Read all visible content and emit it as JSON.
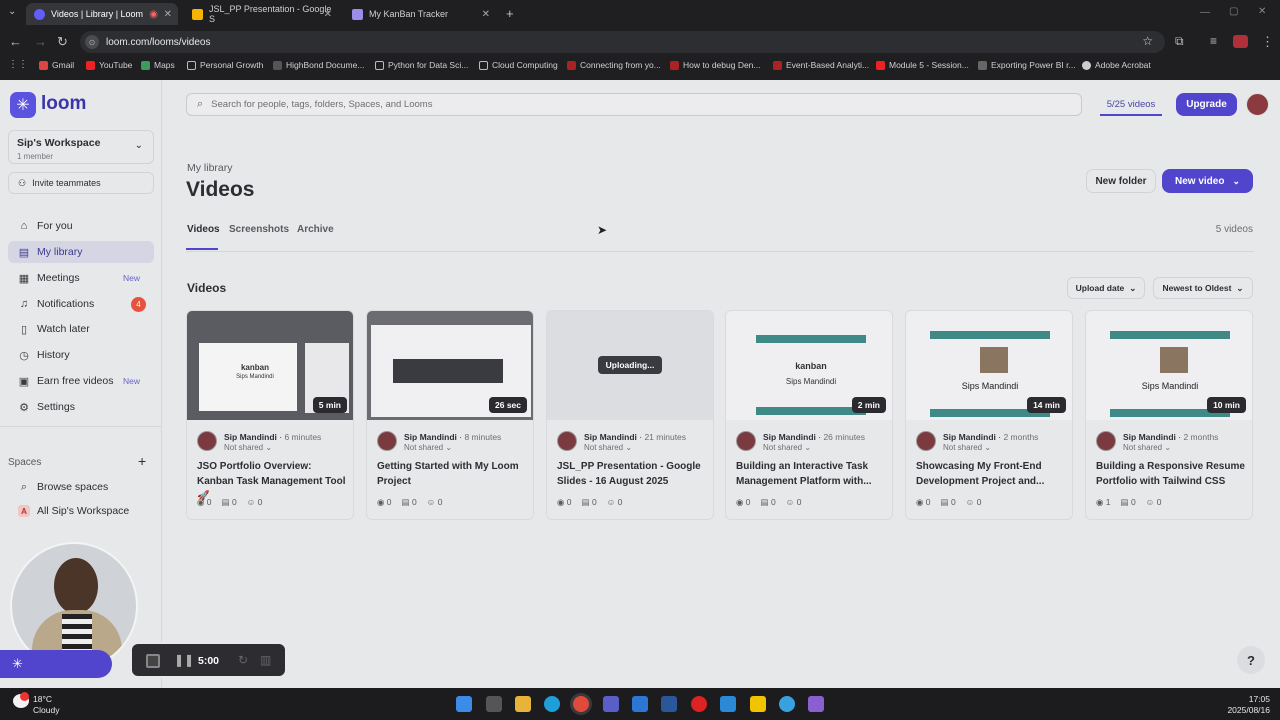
{
  "browser": {
    "tabs": [
      {
        "title": "Videos | Library | Loom",
        "active": true
      },
      {
        "title": "JSL_PP Presentation - Google S",
        "active": false
      },
      {
        "title": "My KanBan Tracker",
        "active": false
      }
    ],
    "url": "loom.com/looms/videos",
    "bookmarks": [
      "Gmail",
      "YouTube",
      "Maps",
      "Personal Growth",
      "HighBond Docume...",
      "Python for Data Sci...",
      "Cloud Computing",
      "Connecting from yo...",
      "How to debug Den...",
      "Event-Based Analyti...",
      "Module 5 - Session...",
      "Exporting Power BI r...",
      "Adobe Acrobat"
    ]
  },
  "app": {
    "logo_text": "loom",
    "search_placeholder": "Search for people, tags, folders, Spaces, and Looms",
    "video_quota": "5/25 videos",
    "upgrade_label": "Upgrade",
    "workspace": {
      "name": "Sip's Workspace",
      "members": "1 member"
    },
    "invite_label": "Invite teammates",
    "nav": [
      {
        "label": "For you",
        "icon": "home-icon"
      },
      {
        "label": "My library",
        "icon": "library-icon",
        "active": true
      },
      {
        "label": "Meetings",
        "icon": "calendar-icon",
        "badge": "New"
      },
      {
        "label": "Notifications",
        "icon": "bell-icon",
        "count": "4"
      },
      {
        "label": "Watch later",
        "icon": "bookmark-icon"
      },
      {
        "label": "History",
        "icon": "history-icon"
      },
      {
        "label": "Earn free videos",
        "icon": "gift-icon",
        "badge": "New"
      },
      {
        "label": "Settings",
        "icon": "gear-icon"
      }
    ],
    "spaces_label": "Spaces",
    "spaces": [
      {
        "label": "Browse spaces",
        "icon": "search-icon"
      },
      {
        "label": "All Sip's Workspace",
        "icon": "A"
      }
    ],
    "breadcrumb": "My library",
    "page_title": "Videos",
    "new_folder_label": "New folder",
    "new_video_label": "New video",
    "tabs": [
      "Videos",
      "Screenshots",
      "Archive"
    ],
    "video_count": "5 videos",
    "section_title": "Videos",
    "sort_field": "Upload date",
    "sort_order": "Newest to Oldest",
    "videos": [
      {
        "owner": "Sip Mandindi",
        "time": "6 minutes",
        "shared": "Not shared",
        "title": "JSO Portfolio Overview: Kanban Task Management Tool 🚀",
        "duration": "5 min",
        "views": "0",
        "comments": "0",
        "reactions": "0",
        "thumb_text": "kanban",
        "thumb_sub": "Sips Mandindi"
      },
      {
        "owner": "Sip Mandindi",
        "time": "8 minutes",
        "shared": "Not shared",
        "title": "Getting Started with My Loom Project",
        "duration": "26 sec",
        "views": "0",
        "comments": "0",
        "reactions": "0",
        "thumb_text": "",
        "thumb_sub": ""
      },
      {
        "owner": "Sip Mandindi",
        "time": "21 minutes",
        "shared": "Not shared",
        "title": "JSL_PP Presentation - Google Slides - 16 August 2025",
        "duration": "",
        "uploading": "Uploading...",
        "views": "0",
        "comments": "0",
        "reactions": "0",
        "thumb_text": "",
        "thumb_sub": ""
      },
      {
        "owner": "Sip Mandindi",
        "time": "26 minutes",
        "shared": "Not shared",
        "title": "Building an Interactive Task Management Platform with...",
        "duration": "2 min",
        "views": "0",
        "comments": "0",
        "reactions": "0",
        "thumb_text": "kanban",
        "thumb_sub": "Sips Mandindi"
      },
      {
        "owner": "Sip Mandindi",
        "time": "2 months",
        "shared": "Not shared",
        "title": "Showcasing My Front-End Development Project and...",
        "duration": "14 min",
        "views": "0",
        "comments": "0",
        "reactions": "0",
        "thumb_text": "",
        "thumb_sub": "Sips Mandindi"
      },
      {
        "owner": "Sip Mandindi",
        "time": "2 months",
        "shared": "Not shared",
        "title": "Building a Responsive Resume Portfolio with Tailwind CSS",
        "duration": "10 min",
        "views": "1",
        "comments": "0",
        "reactions": "0",
        "thumb_text": "",
        "thumb_sub": "Sips Mandindi"
      }
    ],
    "recorder_time": "5:00",
    "help_label": "?"
  },
  "taskbar": {
    "weather_temp": "18°C",
    "weather_desc": "Cloudy",
    "time": "17:05",
    "date": "2025/08/16"
  },
  "colors": {
    "accent": "#5145cd",
    "badge_red": "#e5533d"
  }
}
